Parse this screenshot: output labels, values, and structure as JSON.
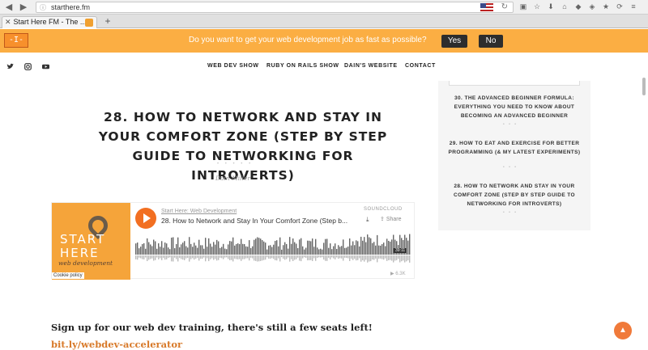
{
  "browser": {
    "url": "starthere.fm",
    "tab_title": "Start Here FM - The ...",
    "tab_close": "✕",
    "new_tab": "+"
  },
  "banner": {
    "logo_text": "-I-",
    "question": "Do you want to get your web development job as fast as possible?",
    "yes_label": "Yes",
    "no_label": "No",
    "color": "#fbae43"
  },
  "social": {
    "twitter_icon": "twitter-icon",
    "instagram_icon": "instagram-icon",
    "youtube_icon": "youtube-icon"
  },
  "nav": {
    "items": [
      "WEB DEV SHOW",
      "RUBY ON RAILS SHOW",
      "DAIN'S WEBSITE",
      "CONTACT"
    ]
  },
  "article": {
    "title": "28. HOW TO NETWORK AND STAY IN YOUR COMFORT ZONE (STEP BY STEP GUIDE TO NETWORKING FOR INTROVERTS)",
    "stars": "• • • • •",
    "author": "Dain Miller"
  },
  "player": {
    "art_title": "START HERE",
    "art_subtitle": "web development",
    "cookie_label": "Cookie policy",
    "artist": "Start Here: Web Development",
    "track": "28. How to Network and Stay In Your Comfort Zone (Step b...",
    "soundcloud_label": "SOUNDCLOUD",
    "share_label": "Share",
    "duration": "39:11",
    "plays": "6.3K"
  },
  "sidebar": {
    "items": [
      "30. THE ADVANCED BEGINNER FORMULA: EVERYTHING YOU NEED TO KNOW ABOUT BECOMING AN ADVANCED BEGINNER",
      "29. HOW TO EAT AND EXERCISE FOR BETTER PROGRAMMING (& MY LATEST EXPERIMENTS)",
      "28. HOW TO NETWORK AND STAY IN YOUR COMFORT ZONE (STEP BY STEP GUIDE TO NETWORKING FOR INTROVERTS)"
    ],
    "stars": "• • •"
  },
  "signup": {
    "text": "Sign up for our web dev training, there's still a few seats left!",
    "link": "bit.ly/webdev-accelerator"
  },
  "colors": {
    "accent": "#f26f21",
    "link": "#d87a2a"
  }
}
